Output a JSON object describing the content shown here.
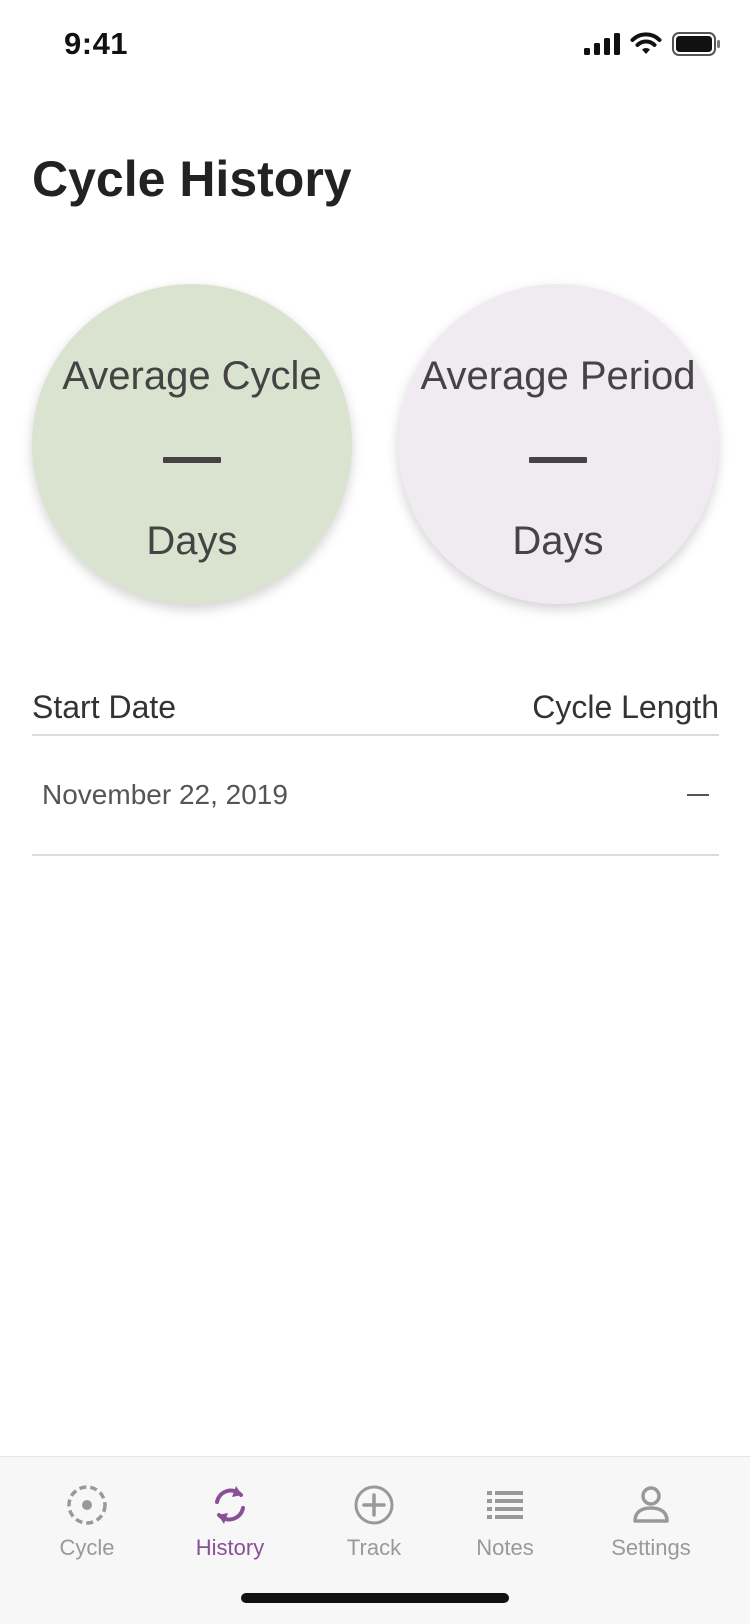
{
  "status_bar": {
    "time": "9:41"
  },
  "page": {
    "title": "Cycle History"
  },
  "stats": {
    "average_cycle": {
      "label": "Average Cycle",
      "value": "—",
      "unit": "Days",
      "color": "#d9e3cf"
    },
    "average_period": {
      "label": "Average Period",
      "value": "—",
      "unit": "Days",
      "color": "#efebf1"
    }
  },
  "table": {
    "headers": {
      "start_date": "Start Date",
      "cycle_length": "Cycle Length"
    },
    "rows": [
      {
        "start_date": "November 22, 2019",
        "cycle_length": "—"
      }
    ]
  },
  "tab_bar": {
    "active_color": "#8a4f96",
    "inactive_color": "#999999",
    "tabs": [
      {
        "label": "Cycle",
        "icon": "cycle-target-icon",
        "active": false
      },
      {
        "label": "History",
        "icon": "refresh-icon",
        "active": true
      },
      {
        "label": "Track",
        "icon": "add-circle-icon",
        "active": false
      },
      {
        "label": "Notes",
        "icon": "list-icon",
        "active": false
      },
      {
        "label": "Settings",
        "icon": "person-icon",
        "active": false
      }
    ]
  }
}
